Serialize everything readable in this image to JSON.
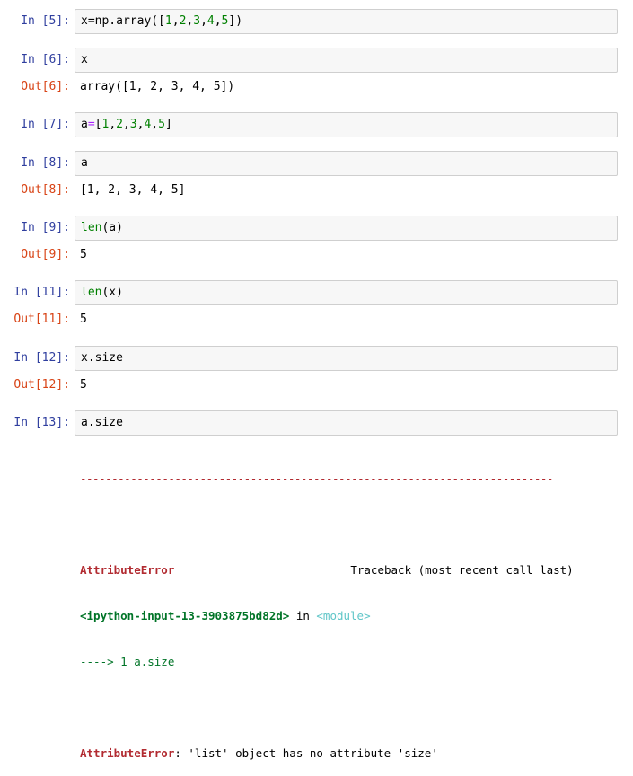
{
  "cells": [
    {
      "in_prompt": "In [5]:",
      "code_parts": [
        "x=np.array([",
        "1",
        ",",
        "2",
        ",",
        "3",
        ",",
        "4",
        ",",
        "5",
        "])"
      ]
    },
    {
      "in_prompt": "In [6]:",
      "code": "x",
      "out_prompt": "Out[6]:",
      "output": "array([1, 2, 3, 4, 5])"
    },
    {
      "in_prompt": "In [7]:",
      "code_parts": [
        "a",
        "=",
        "[",
        "1",
        ",",
        "2",
        ",",
        "3",
        ",",
        "4",
        ",",
        "5",
        "]"
      ]
    },
    {
      "in_prompt": "In [8]:",
      "code": "a",
      "out_prompt": "Out[8]:",
      "output": "[1, 2, 3, 4, 5]"
    },
    {
      "in_prompt": "In [9]:",
      "code_parts": [
        "len",
        "(a)"
      ],
      "out_prompt": "Out[9]:",
      "output": "5"
    },
    {
      "in_prompt": "In [11]:",
      "code_parts": [
        "len",
        "(x)"
      ],
      "out_prompt": "Out[11]:",
      "output": "5"
    },
    {
      "in_prompt": "In [12]:",
      "code": "x.size",
      "out_prompt": "Out[12]:",
      "output": "5"
    },
    {
      "in_prompt": "In [13]:",
      "code": "a.size"
    }
  ],
  "traceback": {
    "dashes": "---------------------------------------------------------------------------",
    "dash_wrap": "-",
    "error_name": "AttributeError",
    "traceback_label": "Traceback (most recent call last)",
    "location": "<ipython-input-13-3903875bd82d>",
    "location_in": " in ",
    "module": "<module>",
    "arrow_line": "----> 1 a.size",
    "error_message": ": 'list' object has no attribute 'size'"
  },
  "colors": {
    "in_prompt": "#303f9f",
    "out_prompt": "#d84315",
    "number": "#008000",
    "builtin": "#008000",
    "error_red": "#b22b31",
    "traceback_green": "#007427",
    "module_cyan": "#60c6c8"
  }
}
